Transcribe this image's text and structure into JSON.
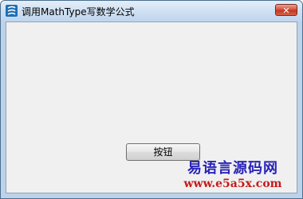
{
  "window": {
    "title": "调用MathType写数学公式",
    "close_label": "✕"
  },
  "main": {
    "button_label": "按钮"
  },
  "watermark": {
    "title": "易语言源码网",
    "url": "www.e5a5x.com"
  },
  "colors": {
    "client_bg": "#f0f0f0",
    "close_red": "#c23820",
    "watermark_blue": "#2a24b8",
    "watermark_red": "#c41a1a"
  },
  "icons": {
    "app": "app-icon",
    "close": "close-icon"
  }
}
